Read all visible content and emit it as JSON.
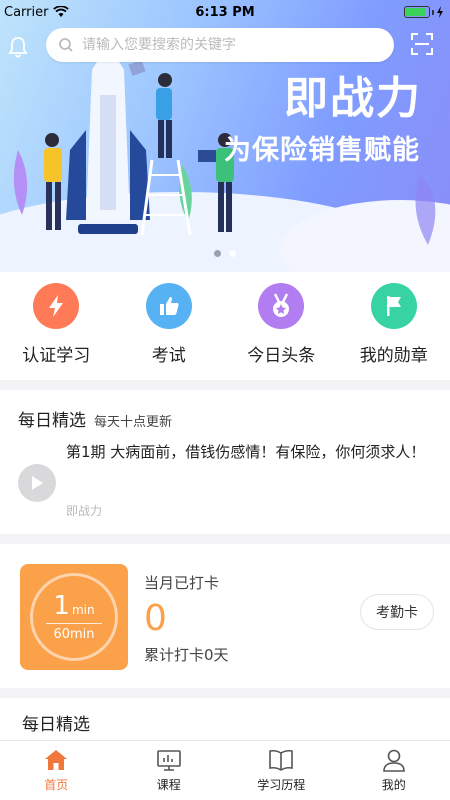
{
  "status_bar": {
    "carrier": "Carrier",
    "time": "6:13 PM",
    "battery_level": 0.9
  },
  "search": {
    "placeholder": "请输入您要搜索的关键字"
  },
  "banner": {
    "title": "即战力",
    "subtitle": "为保险销售赋能",
    "page_count": 2,
    "active_index": 0
  },
  "quick_entries": [
    {
      "label": "认证学习",
      "icon": "lightning-icon",
      "color": "#ff7b58"
    },
    {
      "label": "考试",
      "icon": "thumbs-up-icon",
      "color": "#57b2f3"
    },
    {
      "label": "今日头条",
      "icon": "medal-icon",
      "color": "#b27df0"
    },
    {
      "label": "我的勋章",
      "icon": "flag-icon",
      "color": "#37d3a2"
    }
  ],
  "daily": {
    "title": "每日精选",
    "subtitle": "每天十点更新",
    "article_title": "第1期 大病面前，借钱伤感情！有保险，你何须求人！",
    "article_source": "即战力"
  },
  "checkin": {
    "minutes": "1",
    "minutes_unit": "min",
    "target": "60min",
    "month_label": "当月已打卡",
    "month_count": "0",
    "total_label": "累计打卡0天",
    "attendance_button": "考勤卡"
  },
  "daily_bottom_title": "每日精选",
  "tabs": [
    {
      "label": "首页",
      "icon": "home-icon",
      "active": true
    },
    {
      "label": "课程",
      "icon": "monitor-icon",
      "active": false
    },
    {
      "label": "学习历程",
      "icon": "book-icon",
      "active": false
    },
    {
      "label": "我的",
      "icon": "user-icon",
      "active": false
    }
  ],
  "colors": {
    "accent": "#f0783c",
    "checkin": "#fba14a"
  }
}
